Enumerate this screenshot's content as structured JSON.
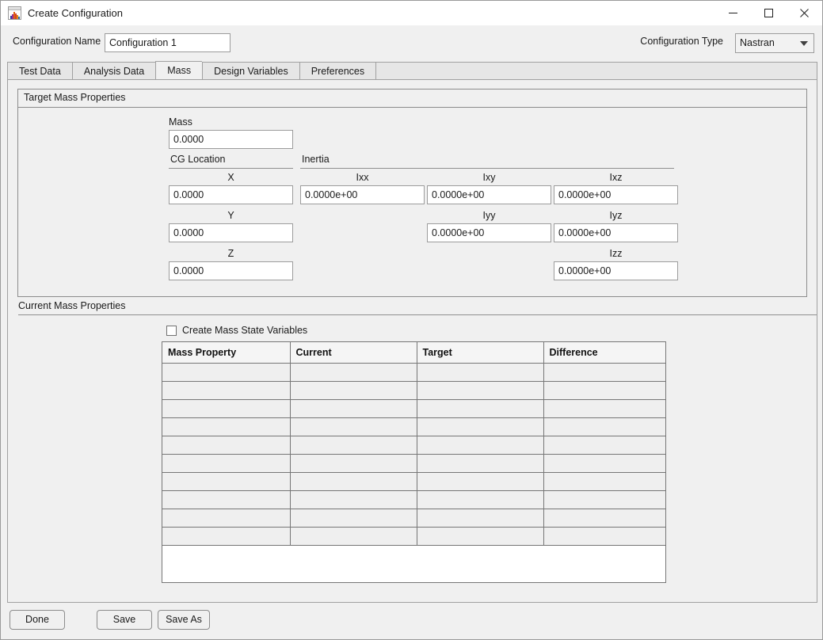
{
  "window": {
    "title": "Create Configuration",
    "icon": "matlab-app-icon",
    "controls": {
      "minimize": "minimize-icon",
      "maximize": "maximize-icon",
      "close": "close-icon"
    }
  },
  "config": {
    "name_label": "Configuration Name",
    "name_value": "Configuration 1",
    "type_label": "Configuration Type",
    "type_value": "Nastran"
  },
  "tabs": [
    {
      "label": "Test Data",
      "active": false
    },
    {
      "label": "Analysis Data",
      "active": false
    },
    {
      "label": "Mass",
      "active": true
    },
    {
      "label": "Design Variables",
      "active": false
    },
    {
      "label": "Preferences",
      "active": false
    }
  ],
  "target_mass": {
    "group_title": "Target Mass Properties",
    "mass_label": "Mass",
    "mass_value": "0.0000",
    "cg_section_label": "CG Location",
    "inertia_section_label": "Inertia",
    "cg": [
      {
        "label": "X",
        "value": "0.0000"
      },
      {
        "label": "Y",
        "value": "0.0000"
      },
      {
        "label": "Z",
        "value": "0.0000"
      }
    ],
    "inertia": {
      "ixx": {
        "label": "Ixx",
        "value": "0.0000e+00"
      },
      "ixy": {
        "label": "Ixy",
        "value": "0.0000e+00"
      },
      "ixz": {
        "label": "Ixz",
        "value": "0.0000e+00"
      },
      "iyy": {
        "label": "Iyy",
        "value": "0.0000e+00"
      },
      "iyz": {
        "label": "Iyz",
        "value": "0.0000e+00"
      },
      "izz": {
        "label": "Izz",
        "value": "0.0000e+00"
      }
    }
  },
  "current_mass": {
    "section_title": "Current Mass Properties",
    "checkbox_label": "Create Mass State Variables",
    "checkbox_checked": false,
    "table": {
      "columns": [
        "Mass Property",
        "Current",
        "Target",
        "Difference"
      ],
      "rows": [
        [
          "",
          "",
          "",
          ""
        ],
        [
          "",
          "",
          "",
          ""
        ],
        [
          "",
          "",
          "",
          ""
        ],
        [
          "",
          "",
          "",
          ""
        ],
        [
          "",
          "",
          "",
          ""
        ],
        [
          "",
          "",
          "",
          ""
        ],
        [
          "",
          "",
          "",
          ""
        ],
        [
          "",
          "",
          "",
          ""
        ],
        [
          "",
          "",
          "",
          ""
        ],
        [
          "",
          "",
          "",
          ""
        ]
      ]
    }
  },
  "footer": {
    "done_label": "Done",
    "save_label": "Save",
    "save_as_label": "Save As"
  },
  "colors": {
    "window_bg": "#f0f0f0",
    "titlebar_bg": "#ffffff",
    "field_bg": "#ffffff",
    "border": "#9c9c9c",
    "table_row_bg": "#efefef",
    "tab_inactive_bg": "#e6e6e6"
  }
}
